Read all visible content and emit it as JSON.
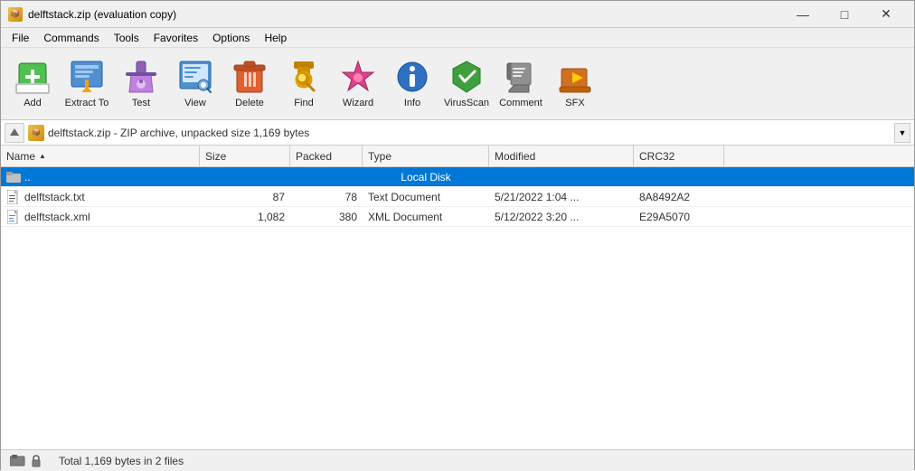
{
  "window": {
    "title": "delftstack.zip (evaluation copy)",
    "icon": "📦"
  },
  "titlebar": {
    "minimize": "—",
    "maximize": "□",
    "close": "✕"
  },
  "menu": {
    "items": [
      "File",
      "Commands",
      "Tools",
      "Favorites",
      "Options",
      "Help"
    ]
  },
  "toolbar": {
    "buttons": [
      {
        "id": "add",
        "label": "Add",
        "icon": "➕",
        "color": "#2a7e2a"
      },
      {
        "id": "extract",
        "label": "Extract To",
        "icon": "📤",
        "color": "#1a6ebf"
      },
      {
        "id": "test",
        "label": "Test",
        "icon": "🔬",
        "color": "#8b3a8b"
      },
      {
        "id": "view",
        "label": "View",
        "icon": "🔍",
        "color": "#1a6ebf"
      },
      {
        "id": "delete",
        "label": "Delete",
        "icon": "🗑",
        "color": "#cc3300"
      },
      {
        "id": "find",
        "label": "Find",
        "icon": "🔦",
        "color": "#cc8800"
      },
      {
        "id": "wizard",
        "label": "Wizard",
        "icon": "🧙",
        "color": "#cc3366"
      },
      {
        "id": "info",
        "label": "Info",
        "icon": "ℹ",
        "color": "#0055cc"
      },
      {
        "id": "virusscan",
        "label": "VirusScan",
        "icon": "🛡",
        "color": "#228833"
      },
      {
        "id": "comment",
        "label": "Comment",
        "icon": "📝",
        "color": "#555555"
      },
      {
        "id": "sfx",
        "label": "SFX",
        "icon": "⚙",
        "color": "#cc6600"
      }
    ]
  },
  "addressbar": {
    "text": "delftstack.zip - ZIP archive, unpacked size 1,169 bytes"
  },
  "table": {
    "headers": [
      {
        "id": "name",
        "label": "Name",
        "sort": "asc"
      },
      {
        "id": "size",
        "label": "Size"
      },
      {
        "id": "packed",
        "label": "Packed"
      },
      {
        "id": "type",
        "label": "Type"
      },
      {
        "id": "modified",
        "label": "Modified"
      },
      {
        "id": "crc32",
        "label": "CRC32"
      }
    ],
    "rows": [
      {
        "id": "parent",
        "name": "..",
        "size": "",
        "packed": "",
        "type": "Local Disk",
        "modified": "",
        "crc32": "",
        "selected": true,
        "icon": "💾",
        "icon_type": "disk"
      },
      {
        "id": "txt",
        "name": "delftstack.txt",
        "size": "87",
        "packed": "78",
        "type": "Text Document",
        "modified": "5/21/2022 1:04 ...",
        "crc32": "8A8492A2",
        "selected": false,
        "icon": "📄",
        "icon_type": "txt"
      },
      {
        "id": "xml",
        "name": "delftstack.xml",
        "size": "1,082",
        "packed": "380",
        "type": "XML Document",
        "modified": "5/12/2022 3:20 ...",
        "crc32": "E29A5070",
        "selected": false,
        "icon": "📋",
        "icon_type": "xml"
      }
    ]
  },
  "statusbar": {
    "text": "Total 1,169 bytes in 2 files"
  }
}
